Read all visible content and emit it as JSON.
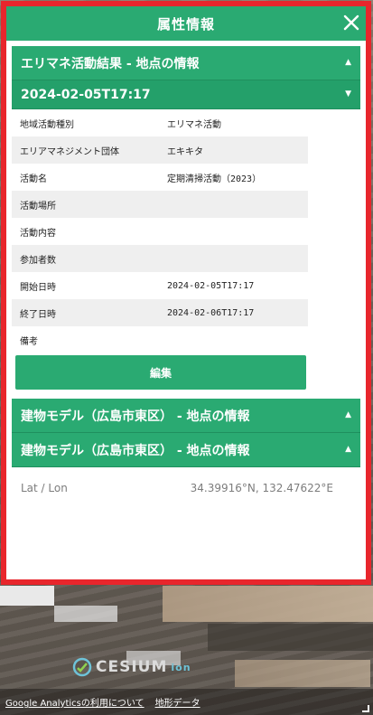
{
  "panel": {
    "title": "属性情報",
    "close_icon": "close-icon"
  },
  "sections": {
    "activity_header": "エリマネ活動結果 - 地点の情報",
    "record_header": "2024-02-05T17:17",
    "building1_header": "建物モデル（広島市東区） - 地点の情報",
    "building2_header": "建物モデル（広島市東区） - 地点の情報"
  },
  "properties": [
    {
      "key": "地域活動種別",
      "value": "エリマネ活動"
    },
    {
      "key": "エリアマネジメント団体",
      "value": "エキキタ"
    },
    {
      "key": "活動名",
      "value": "定期清掃活動（2023）"
    },
    {
      "key": "活動場所",
      "value": ""
    },
    {
      "key": "活動内容",
      "value": ""
    },
    {
      "key": "参加者数",
      "value": ""
    },
    {
      "key": "開始日時",
      "value": "2024-02-05T17:17"
    },
    {
      "key": "終了日時",
      "value": "2024-02-06T17:17"
    },
    {
      "key": "備考",
      "value": ""
    }
  ],
  "edit_button": "編集",
  "latlon": {
    "label": "Lat / Lon",
    "value": "34.39916°N, 132.47622°E"
  },
  "map": {
    "cesium_label": "CESIUM",
    "cesium_suffix": "ion",
    "links": [
      "Google Analyticsの利用について",
      "地形データ"
    ]
  },
  "colors": {
    "accent": "#2aaa72",
    "frame": "#e8262c"
  }
}
